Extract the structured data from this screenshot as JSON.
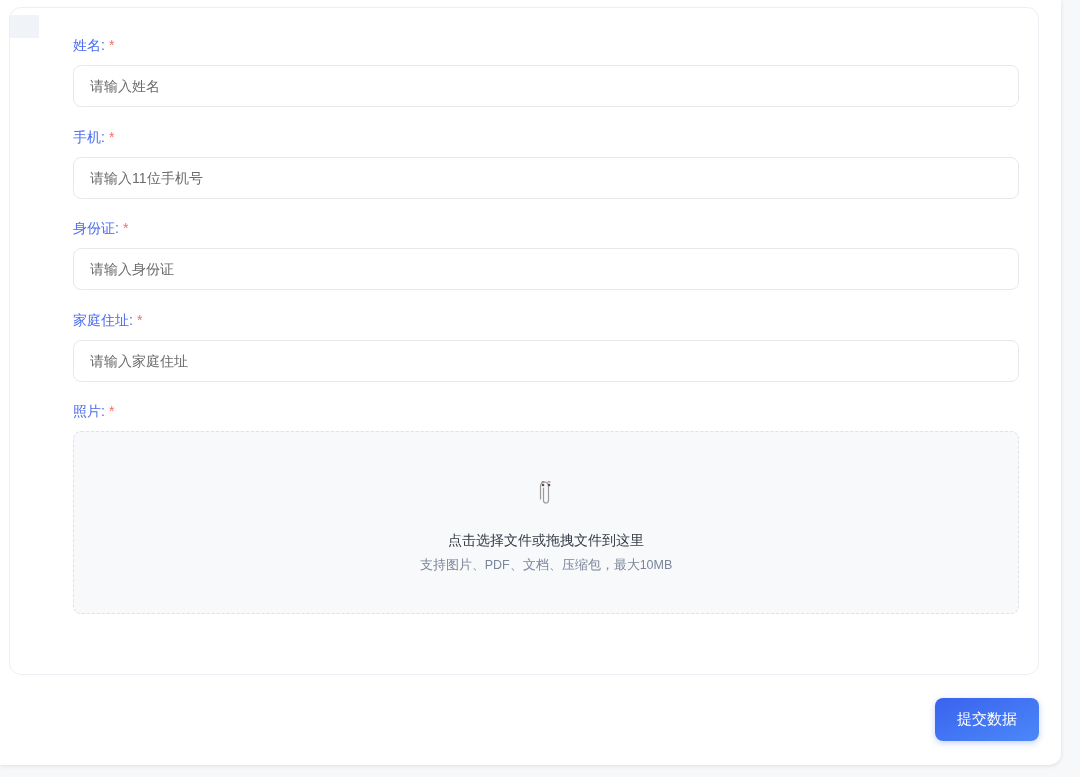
{
  "form": {
    "fields": [
      {
        "kind": "text",
        "label": "姓名:",
        "required_mark": "*",
        "placeholder": "请输入姓名"
      },
      {
        "kind": "text",
        "label": "手机:",
        "required_mark": "*",
        "placeholder": "请输入11位手机号"
      },
      {
        "kind": "text",
        "label": "身份证:",
        "required_mark": "*",
        "placeholder": "请输入身份证"
      },
      {
        "kind": "text",
        "label": "家庭住址:",
        "required_mark": "*",
        "placeholder": "请输入家庭住址"
      },
      {
        "kind": "upload",
        "label": "照片:",
        "required_mark": "*",
        "prompt": "点击选择文件或拖拽文件到这里",
        "hint": "支持图片、PDF、文档、压缩包，最大10MB"
      }
    ]
  },
  "submit_button": "提交数据"
}
